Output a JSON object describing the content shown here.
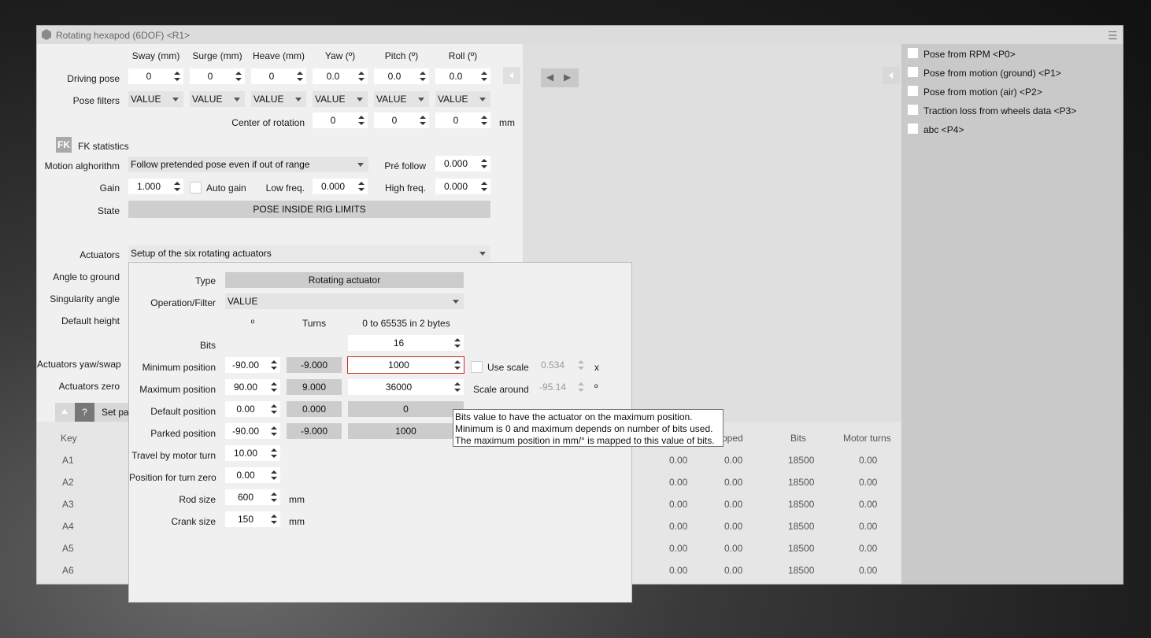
{
  "window": {
    "title": "Rotating hexapod (6DOF) <R1>"
  },
  "pose": {
    "columns": [
      "Sway (mm)",
      "Surge (mm)",
      "Heave (mm)",
      "Yaw (º)",
      "Pitch (º)",
      "Roll (º)"
    ],
    "driving_label": "Driving pose",
    "driving_values": [
      "0",
      "0",
      "0",
      "0.0",
      "0.0",
      "0.0"
    ],
    "filters_label": "Pose filters",
    "filter_values": [
      "VALUE",
      "VALUE",
      "VALUE",
      "VALUE",
      "VALUE",
      "VALUE"
    ],
    "cor_label": "Center of rotation",
    "cor_values": [
      "0",
      "0",
      "0"
    ],
    "cor_unit": "mm"
  },
  "fk": {
    "badge": "FK",
    "label": "FK statistics"
  },
  "motion": {
    "label": "Motion alghorithm",
    "value": "Follow pretended pose even if out of range",
    "pre_follow_label": "Pré follow",
    "pre_follow": "0.000",
    "gain_label": "Gain",
    "gain": "1.000",
    "auto_gain_label": "Auto gain",
    "low_label": "Low freq.",
    "low": "0.000",
    "high_label": "High freq.",
    "high": "0.000",
    "state_label": "State",
    "state": "POSE INSIDE RIG LIMITS"
  },
  "actuators": {
    "label": "Actuators",
    "value": "Setup of the six rotating actuators",
    "side_labels": [
      "Angle to ground",
      "Singularity angle",
      "Default height",
      "Actuators yaw/swap",
      "Actuators zero"
    ]
  },
  "setbar": {
    "q": "?",
    "text": "Set par"
  },
  "grid": {
    "key_header": "Key",
    "keys": [
      "A1",
      "A2",
      "A3",
      "A4",
      "A5",
      "A6"
    ],
    "headers": [
      "pped",
      "Bits",
      "Motor turns"
    ],
    "rows": [
      [
        "0.00",
        "0.00",
        "18500",
        "0.00"
      ],
      [
        "0.00",
        "0.00",
        "18500",
        "0.00"
      ],
      [
        "0.00",
        "0.00",
        "18500",
        "0.00"
      ],
      [
        "0.00",
        "0.00",
        "18500",
        "0.00"
      ],
      [
        "0.00",
        "0.00",
        "18500",
        "0.00"
      ],
      [
        "0.00",
        "0.00",
        "18500",
        "0.00"
      ]
    ]
  },
  "right_panel": {
    "items": [
      "Pose from RPM <P0>",
      "Pose from motion (ground) <P1>",
      "Pose from motion (air) <P2>",
      "Traction loss from wheels data <P3>",
      "abc <P4>"
    ]
  },
  "dialog": {
    "type_label": "Type",
    "type_value": "Rotating actuator",
    "op_label": "Operation/Filter",
    "op_value": "VALUE",
    "col_deg": "º",
    "col_turns": "Turns",
    "col_bits": "0 to 65535 in 2 bytes",
    "bits_label": "Bits",
    "bits_value": "16",
    "rows": [
      {
        "label": "Minimum position",
        "deg": "-90.00",
        "turns": "-9.000",
        "bits": "1000"
      },
      {
        "label": "Maximum position",
        "deg": "90.00",
        "turns": "9.000",
        "bits": "36000"
      },
      {
        "label": "Default position",
        "deg": "0.00",
        "turns": "0.000",
        "bits": "0"
      },
      {
        "label": "Parked position",
        "deg": "-90.00",
        "turns": "-9.000",
        "bits": "1000"
      }
    ],
    "use_scale_label": "Use scale",
    "use_scale_value": "0.534",
    "use_scale_unit": "x",
    "scale_around_label": "Scale around",
    "scale_around_value": "-95.14",
    "scale_around_unit": "º",
    "travel_label": "Travel by motor turn",
    "travel_value": "10.00",
    "turn_zero_label": "Position for turn zero",
    "turn_zero_value": "0.00",
    "rod_label": "Rod size",
    "rod_value": "600",
    "rod_unit": "mm",
    "crank_label": "Crank size",
    "crank_value": "150",
    "crank_unit": "mm"
  },
  "tooltip": {
    "line1": "Bits value to have the actuator on the maximum position.",
    "line2": "Minimum is 0 and maximum depends on number of bits used.",
    "line3": "The maximum position in mm/° is mapped to this value of bits."
  }
}
